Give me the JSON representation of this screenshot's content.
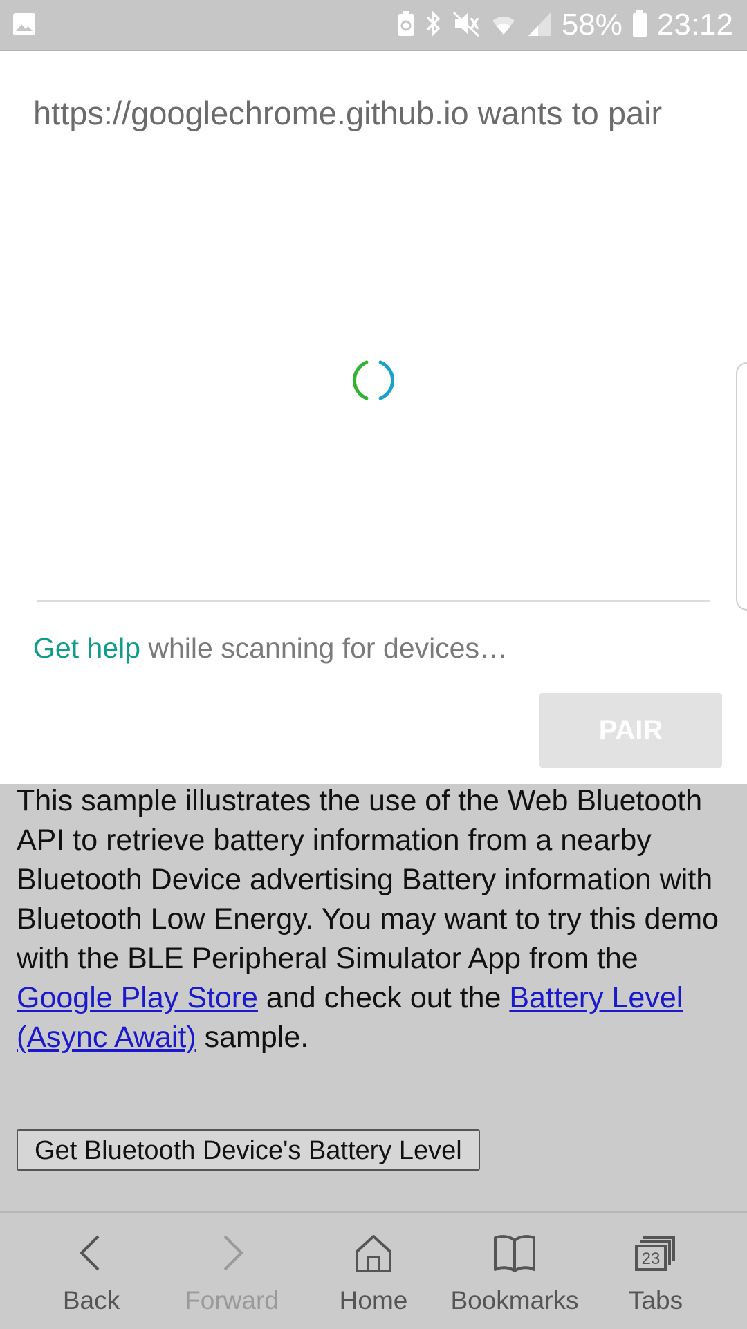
{
  "status_bar": {
    "battery_percent": "58%",
    "time": "23:12",
    "icons": [
      "image-icon",
      "battery-saver-icon",
      "bluetooth-icon",
      "mute-icon",
      "wifi-icon",
      "signal-icon",
      "battery-icon"
    ]
  },
  "dialog": {
    "title": "https://googlechrome.github.io wants to pair",
    "help_link": "Get help",
    "help_text": " while scanning for devices…",
    "pair_label": "PAIR",
    "spinner_colors": [
      "#34b233",
      "#1aa3c8"
    ]
  },
  "page": {
    "paragraph_text": "This sample illustrates the use of the Web Bluetooth API to retrieve battery information from a nearby Bluetooth Device advertising Battery information with Bluetooth Low Energy. You may want to try this demo with the BLE Peripheral Simulator App from the ",
    "link_play_store": "Google Play Store",
    "middle_text": " and check out the ",
    "link_async": "Battery Level (Async Await)",
    "end_text": " sample.",
    "button_label": "Get Bluetooth Device's Battery Level"
  },
  "bottom_nav": {
    "back": "Back",
    "forward": "Forward",
    "home": "Home",
    "bookmarks": "Bookmarks",
    "tabs": "Tabs",
    "tabs_count": "23"
  }
}
